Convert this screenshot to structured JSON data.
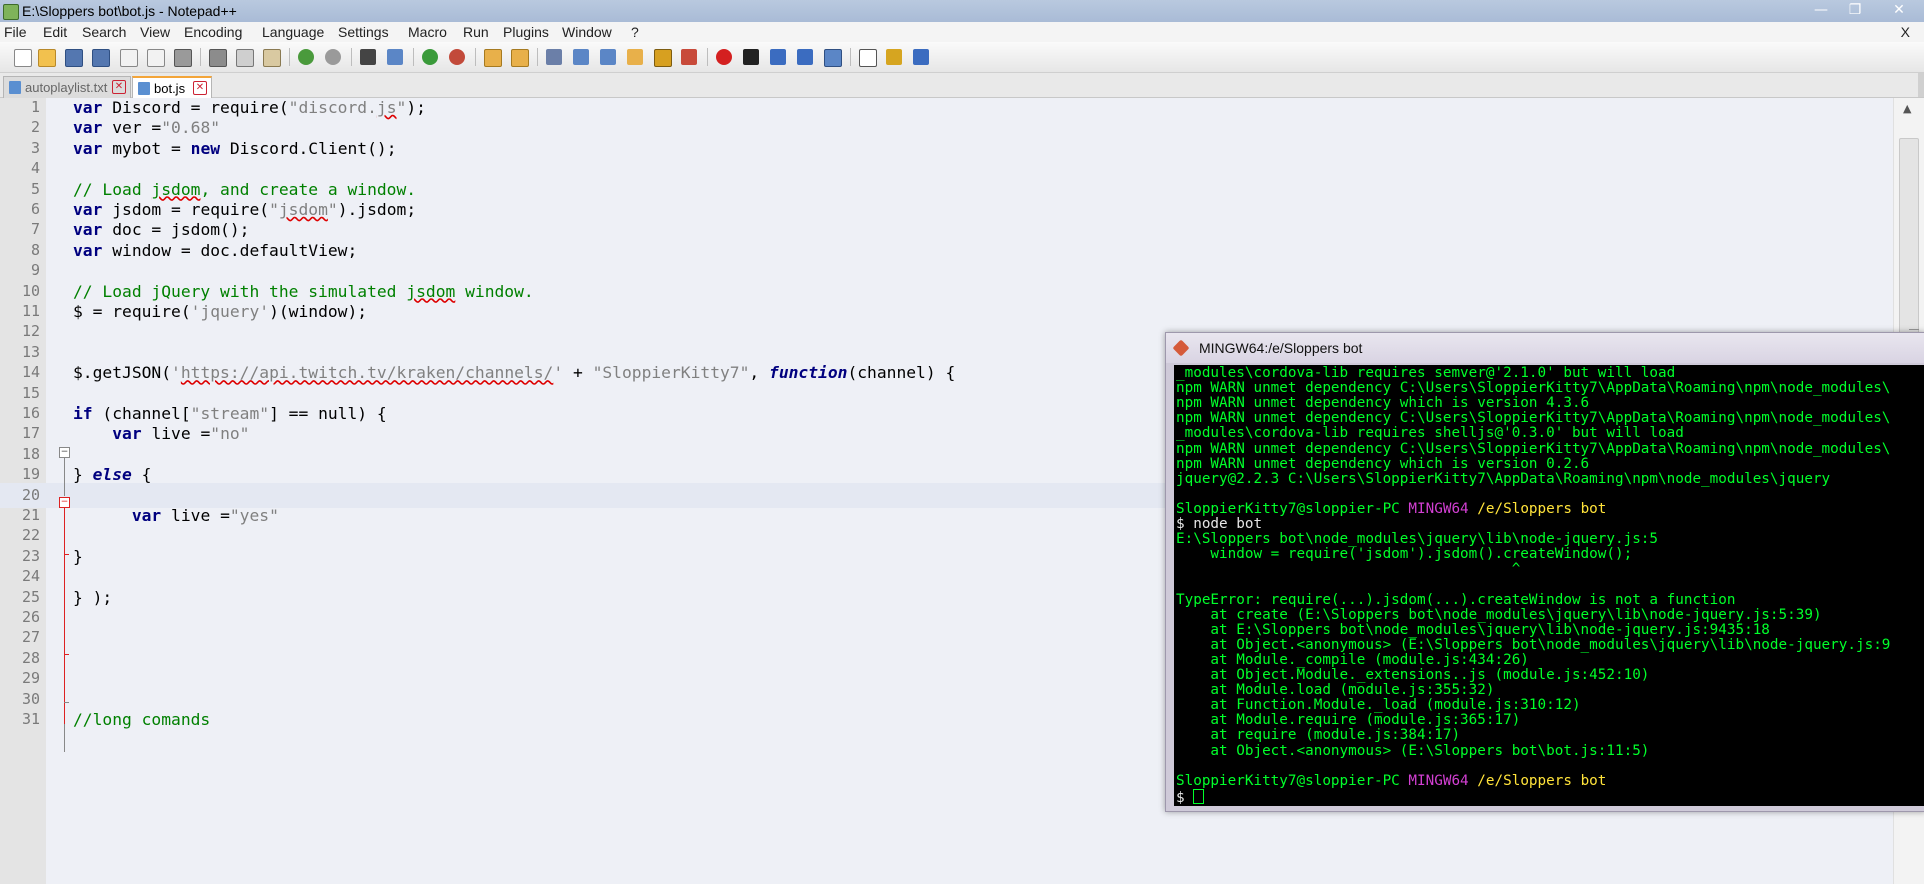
{
  "window": {
    "title": "E:\\Sloppers bot\\bot.js - Notepad++",
    "min_glyph": "—",
    "max_glyph": "❐",
    "close_glyph": "✕"
  },
  "menu": {
    "items": [
      "File",
      "Edit",
      "Search",
      "View",
      "Encoding",
      "Language",
      "Settings",
      "Macro",
      "Run",
      "Plugins",
      "Window",
      "?"
    ],
    "close_x": "X"
  },
  "toolbar": {
    "icons": [
      "new-file-icon",
      "open-file-icon",
      "save-icon",
      "save-all-icon",
      "close-icon",
      "close-all-icon",
      "print-icon",
      "cut-icon",
      "copy-icon",
      "paste-icon",
      "undo-icon",
      "redo-icon",
      "find-icon",
      "replace-icon",
      "zoom-in-icon",
      "zoom-out-icon",
      "sync-v-icon",
      "sync-h-icon",
      "word-wrap-icon",
      "show-all-chars-icon",
      "indent-guide-icon",
      "fold-icon",
      "doc-map-icon",
      "function-list-icon",
      "record-macro-icon",
      "stop-record-icon",
      "play-macro-icon",
      "play-multiple-icon",
      "save-macro-icon",
      "spell-check-icon",
      "spell-next-icon",
      "spell-change-icon"
    ]
  },
  "tabs": [
    {
      "label": "autoplaylist.txt",
      "active": false
    },
    {
      "label": "bot.js",
      "active": true
    }
  ],
  "tab_close_glyph": "✕",
  "editor": {
    "current_line": 20,
    "lines": [
      {
        "n": "1",
        "tokens": [
          [
            "kw",
            "var"
          ],
          [
            "",
            " Discord = require("
          ],
          [
            "str",
            "\"discord."
          ],
          [
            "strsq",
            "js"
          ],
          [
            "str",
            "\""
          ],
          [
            "",
            ");"
          ]
        ]
      },
      {
        "n": "2",
        "tokens": [
          [
            "kw",
            "var"
          ],
          [
            "",
            " ver ="
          ],
          [
            "str",
            "\"0.68\""
          ]
        ]
      },
      {
        "n": "3",
        "tokens": [
          [
            "kw",
            "var"
          ],
          [
            "",
            " mybot = "
          ],
          [
            "kw",
            "new"
          ],
          [
            "",
            " Discord.Client();"
          ]
        ]
      },
      {
        "n": "4",
        "tokens": []
      },
      {
        "n": "5",
        "tokens": [
          [
            "com",
            "// Load "
          ],
          [
            "comsq",
            "jsdom"
          ],
          [
            "com",
            ", and create a window."
          ]
        ]
      },
      {
        "n": "6",
        "tokens": [
          [
            "kw",
            "var"
          ],
          [
            "",
            " jsdom = require("
          ],
          [
            "str",
            "\""
          ],
          [
            "strsq",
            "jsdom"
          ],
          [
            "str",
            "\""
          ],
          [
            "",
            ").jsdom;"
          ]
        ]
      },
      {
        "n": "7",
        "tokens": [
          [
            "kw",
            "var"
          ],
          [
            "",
            " doc = jsdom();"
          ]
        ]
      },
      {
        "n": "8",
        "tokens": [
          [
            "kw",
            "var"
          ],
          [
            "",
            " window = doc.defaultView;"
          ]
        ]
      },
      {
        "n": "9",
        "tokens": []
      },
      {
        "n": "10",
        "tokens": [
          [
            "com",
            "// Load jQuery with the simulated "
          ],
          [
            "comsq",
            "jsdom"
          ],
          [
            "com",
            " window."
          ]
        ]
      },
      {
        "n": "11",
        "tokens": [
          [
            "",
            "$ = require("
          ],
          [
            "str",
            "'jquery'"
          ],
          [
            "",
            ")(window);"
          ]
        ]
      },
      {
        "n": "12",
        "tokens": []
      },
      {
        "n": "13",
        "tokens": []
      },
      {
        "n": "14",
        "tokens": [
          [
            "",
            "$.getJSON("
          ],
          [
            "str",
            "'"
          ],
          [
            "strsq",
            "https://api.twitch.tv/kraken/channels/"
          ],
          [
            "str",
            "'"
          ],
          [
            "",
            " + "
          ],
          [
            "str",
            "\"SloppierKitty7\""
          ],
          [
            "",
            ", "
          ],
          [
            "kwi",
            "function"
          ],
          [
            "",
            "(channel) {"
          ]
        ]
      },
      {
        "n": "15",
        "tokens": []
      },
      {
        "n": "16",
        "tokens": [
          [
            "kw",
            "if"
          ],
          [
            "",
            " (channel["
          ],
          [
            "str",
            "\"stream\""
          ],
          [
            "",
            "] == null) {"
          ]
        ]
      },
      {
        "n": "17",
        "tokens": [
          [
            "",
            "    "
          ],
          [
            "kw",
            "var"
          ],
          [
            "",
            " live ="
          ],
          [
            "str",
            "\"no\""
          ]
        ]
      },
      {
        "n": "18",
        "tokens": []
      },
      {
        "n": "19",
        "tokens": [
          [
            "",
            "} "
          ],
          [
            "kwi",
            "else"
          ],
          [
            "",
            " {"
          ]
        ]
      },
      {
        "n": "20",
        "tokens": []
      },
      {
        "n": "21",
        "tokens": [
          [
            "",
            "      "
          ],
          [
            "kw",
            "var"
          ],
          [
            "",
            " live ="
          ],
          [
            "str",
            "\"yes\""
          ]
        ]
      },
      {
        "n": "22",
        "tokens": []
      },
      {
        "n": "23",
        "tokens": [
          [
            "",
            "}"
          ]
        ]
      },
      {
        "n": "24",
        "tokens": []
      },
      {
        "n": "25",
        "tokens": [
          [
            "",
            "} );"
          ]
        ]
      },
      {
        "n": "26",
        "tokens": []
      },
      {
        "n": "27",
        "tokens": []
      },
      {
        "n": "28",
        "tokens": []
      },
      {
        "n": "29",
        "tokens": []
      },
      {
        "n": "30",
        "tokens": []
      },
      {
        "n": "31",
        "tokens": [
          [
            "com",
            "//long comands"
          ]
        ]
      }
    ]
  },
  "scrollbar": {
    "up_glyph": "▲"
  },
  "terminal": {
    "title": "MINGW64:/e/Sloppers bot",
    "lines": [
      [
        [
          "g",
          "_modules\\cordova-lib requires semver@'2.1.0' but will load"
        ]
      ],
      [
        [
          "g",
          "npm WARN unmet dependency C:\\Users\\SloppierKitty7\\AppData\\Roaming\\npm\\node_modules\\"
        ]
      ],
      [
        [
          "g",
          "npm WARN unmet dependency which is version 4.3.6"
        ]
      ],
      [
        [
          "g",
          "npm WARN unmet dependency C:\\Users\\SloppierKitty7\\AppData\\Roaming\\npm\\node_modules\\"
        ]
      ],
      [
        [
          "g",
          "_modules\\cordova-lib requires shelljs@'0.3.0' but will load"
        ]
      ],
      [
        [
          "g",
          "npm WARN unmet dependency C:\\Users\\SloppierKitty7\\AppData\\Roaming\\npm\\node_modules\\"
        ]
      ],
      [
        [
          "g",
          "npm WARN unmet dependency which is version 0.2.6"
        ]
      ],
      [
        [
          "g",
          "jquery@2.2.3 C:\\Users\\SloppierKitty7\\AppData\\Roaming\\npm\\node_modules\\jquery"
        ]
      ],
      [],
      [
        [
          "g",
          "SloppierKitty7@sloppier-PC "
        ],
        [
          "m",
          "MINGW64"
        ],
        [
          "y",
          " /e/Sloppers bot"
        ]
      ],
      [
        [
          "w",
          "$ node bot"
        ]
      ],
      [
        [
          "g",
          "E:\\Sloppers bot\\node_modules\\jquery\\lib\\node-jquery.js:5"
        ]
      ],
      [
        [
          "g",
          "    window = require('jsdom').jsdom().createWindow();"
        ]
      ],
      [
        [
          "g",
          "                                       ^"
        ]
      ],
      [],
      [
        [
          "g",
          "TypeError: require(...).jsdom(...).createWindow is not a function"
        ]
      ],
      [
        [
          "g",
          "    at create (E:\\Sloppers bot\\node_modules\\jquery\\lib\\node-jquery.js:5:39)"
        ]
      ],
      [
        [
          "g",
          "    at E:\\Sloppers bot\\node_modules\\jquery\\lib\\node-jquery.js:9435:18"
        ]
      ],
      [
        [
          "g",
          "    at Object.<anonymous> (E:\\Sloppers bot\\node_modules\\jquery\\lib\\node-jquery.js:9"
        ]
      ],
      [
        [
          "g",
          "    at Module._compile (module.js:434:26)"
        ]
      ],
      [
        [
          "g",
          "    at Object.Module._extensions..js (module.js:452:10)"
        ]
      ],
      [
        [
          "g",
          "    at Module.load (module.js:355:32)"
        ]
      ],
      [
        [
          "g",
          "    at Function.Module._load (module.js:310:12)"
        ]
      ],
      [
        [
          "g",
          "    at Module.require (module.js:365:17)"
        ]
      ],
      [
        [
          "g",
          "    at require (module.js:384:17)"
        ]
      ],
      [
        [
          "g",
          "    at Object.<anonymous> (E:\\Sloppers bot\\bot.js:11:5)"
        ]
      ],
      [],
      [
        [
          "g",
          "SloppierKitty7@sloppier-PC "
        ],
        [
          "m",
          "MINGW64"
        ],
        [
          "y",
          " /e/Sloppers bot"
        ]
      ],
      [
        [
          "w",
          "$ "
        ],
        [
          "cursor",
          ""
        ]
      ]
    ]
  }
}
